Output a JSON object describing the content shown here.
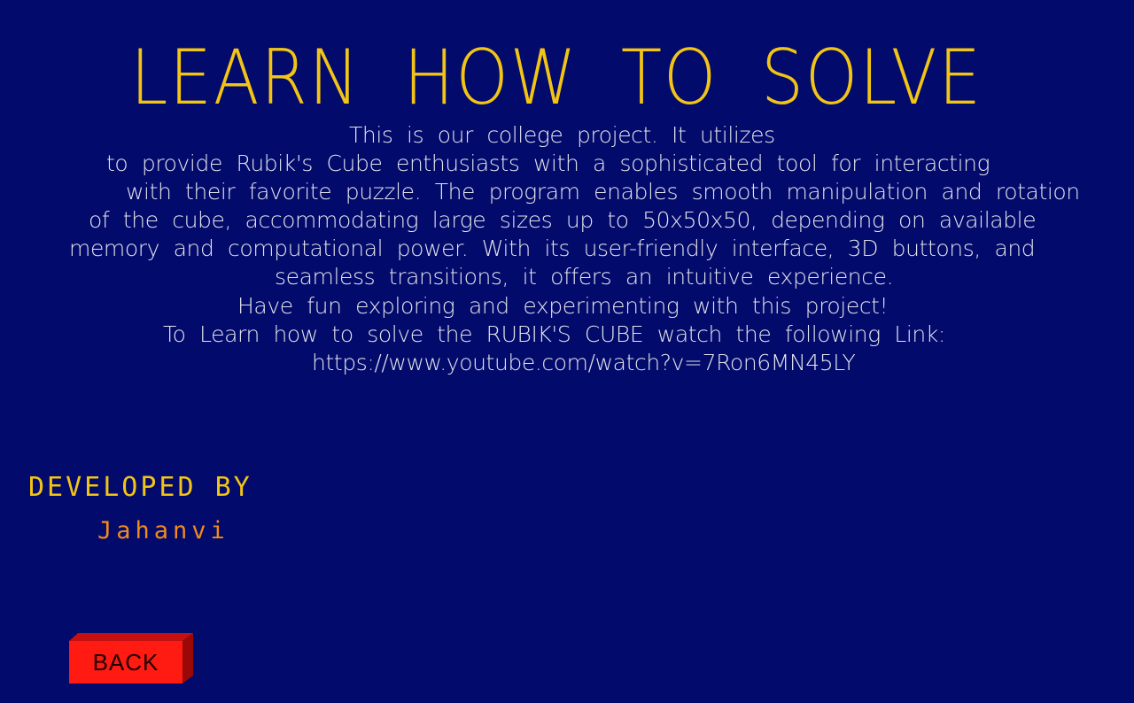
{
  "title": "LEARN HOW TO SOLVE",
  "description_lines": [
    "This is our college project. It utilizes",
    "to provide Rubik's Cube enthusiasts with a sophisticated tool for interacting",
    "with their favorite puzzle. The program enables smooth manipulation and rotation",
    "of the cube, accommodating large sizes up to 50x50x50, depending on available",
    "memory and computational power. With its user-friendly interface, 3D buttons, and",
    "seamless transitions, it offers an intuitive experience.",
    "Have fun exploring and experimenting with this project!",
    "To Learn how to solve the RUBIK'S CUBE watch the following Link:",
    "https://www.youtube.com/watch?v=7Ron6MN45LY"
  ],
  "credits": {
    "heading": "DEVELOPED BY",
    "name": "Jahanvi"
  },
  "back_button": {
    "label": "BACK"
  },
  "colors": {
    "background": "#020a6c",
    "title": "#f2c416",
    "body_text": "#e3e3ea",
    "developer_name": "#f08a1c",
    "button_face": "#ff1a12",
    "button_side": "#9a0808"
  }
}
